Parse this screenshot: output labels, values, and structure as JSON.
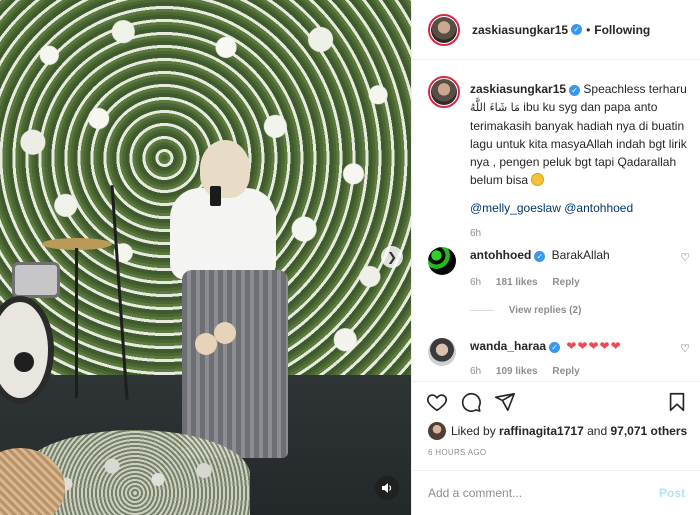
{
  "header": {
    "username": "zaskiasungkar15",
    "separator": "•",
    "follow_label": "Following"
  },
  "caption": {
    "username": "zaskiasungkar15",
    "text_before_arabic": "Speachless terharu",
    "arabic": "مَا شَاءَ اللَّهُ",
    "text_after_arabic": "ibu ku syg dan papa anto terimakasih banyak hadiah nya di buatin lagu untuk kita masyaAllah indah bgt lirik nya , pengen peluk bgt tapi Qadarallah belum bisa",
    "mentions": [
      "@melly_goeslaw",
      "@antohhoed"
    ],
    "time": "6h"
  },
  "comments": [
    {
      "username": "antohhoed",
      "text": "BarakAllah",
      "time": "6h",
      "likes": "181 likes",
      "reply_label": "Reply",
      "view_replies": "View replies (2)"
    },
    {
      "username": "wanda_haraa",
      "text": "❤❤❤❤❤",
      "time": "6h",
      "likes": "109 likes",
      "reply_label": "Reply"
    }
  ],
  "likes_line": {
    "prefix": "Liked by",
    "user": "raffinagita1717",
    "and": "and",
    "others": "97,071 others"
  },
  "time_ago": "6 HOURS AGO",
  "comment_box": {
    "placeholder": "Add a comment...",
    "post_label": "Post"
  },
  "colors": {
    "verified": "#3897f0",
    "story_ring": "#dc2743",
    "heart": "#ed4956",
    "post_disabled": "#b2dffc",
    "mention": "#00376b"
  },
  "icons": [
    "next-arrow-icon",
    "sound-icon",
    "heart-icon",
    "comment-icon",
    "share-icon",
    "bookmark-icon",
    "verified-icon"
  ]
}
